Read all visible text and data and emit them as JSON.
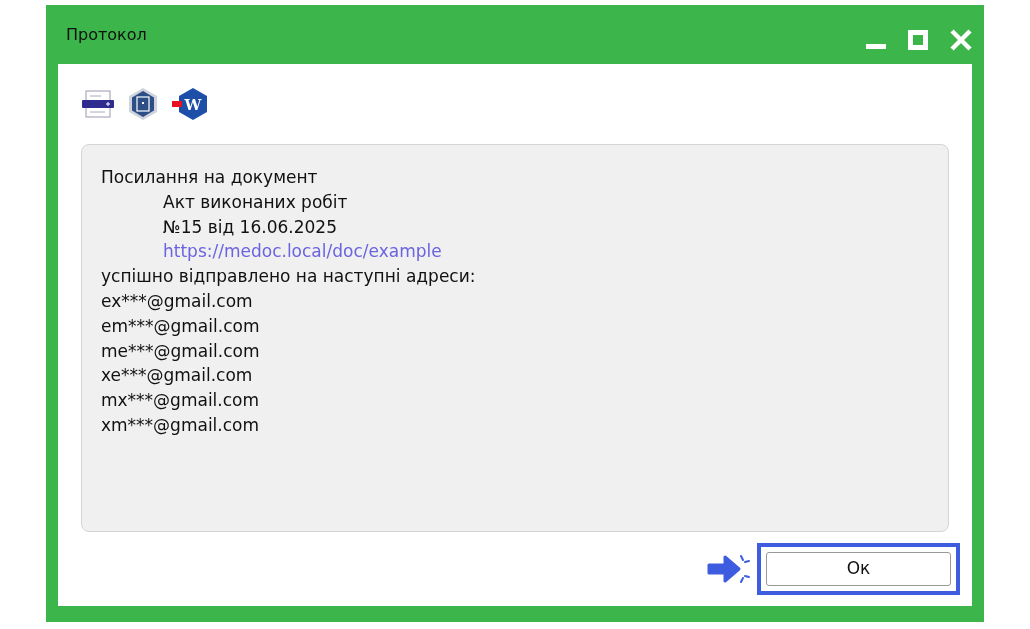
{
  "window": {
    "title": "Протокол"
  },
  "toolbar": {
    "export_icon_letter": "W"
  },
  "message": {
    "lines": [
      {
        "kind": "plain",
        "text": "Посилання на документ"
      },
      {
        "kind": "indent",
        "text": "Акт виконаних робіт"
      },
      {
        "kind": "indent",
        "text": "№15 від 16.06.2025"
      },
      {
        "kind": "link",
        "text": "https://medoc.local/doc/example"
      },
      {
        "kind": "plain",
        "text": "успішно відправлено на наступні адреси:"
      },
      {
        "kind": "plain",
        "text": "ex***@gmail.com"
      },
      {
        "kind": "plain",
        "text": "em***@gmail.com"
      },
      {
        "kind": "plain",
        "text": "me***@gmail.com"
      },
      {
        "kind": "plain",
        "text": "xe***@gmail.com"
      },
      {
        "kind": "plain",
        "text": "mx***@gmail.com"
      },
      {
        "kind": "plain",
        "text": "xm***@gmail.com"
      }
    ]
  },
  "buttons": [
    {
      "label": "Ок",
      "highlighted": true
    }
  ]
}
